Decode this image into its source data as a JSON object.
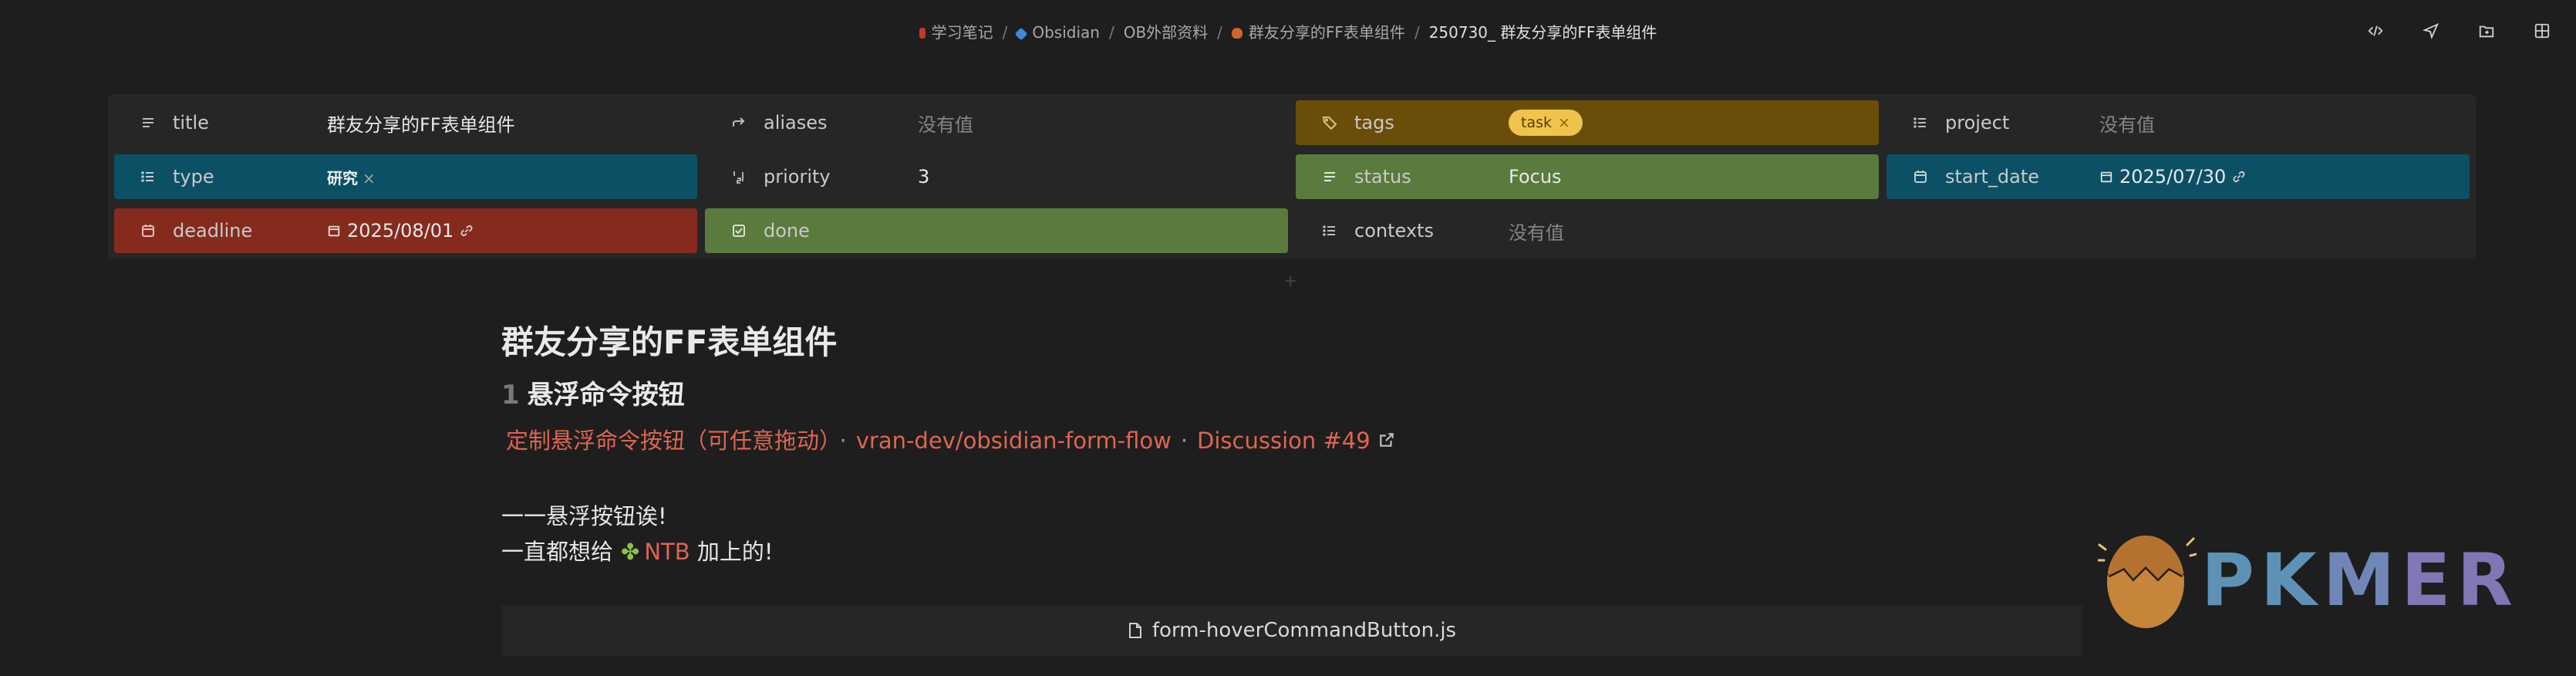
{
  "breadcrumb": {
    "items": [
      "学习笔记",
      "Obsidian",
      "OB外部资料",
      "群友分享的FF表单组件",
      "250730_ 群友分享的FF表单组件"
    ],
    "separator": "/"
  },
  "top_actions": [
    "code-icon",
    "send-icon",
    "folder-move-icon",
    "grid-icon"
  ],
  "properties": {
    "title": {
      "key": "title",
      "value": "群友分享的FF表单组件"
    },
    "aliases": {
      "key": "aliases",
      "value": "没有值"
    },
    "tags": {
      "key": "tags",
      "tag": "task",
      "remove": "×"
    },
    "project": {
      "key": "project",
      "value": "没有值"
    },
    "type": {
      "key": "type",
      "tag": "研究",
      "remove": "×"
    },
    "priority": {
      "key": "priority",
      "value": "3"
    },
    "status": {
      "key": "status",
      "value": "Focus"
    },
    "start_date": {
      "key": "start_date",
      "value": "2025/07/30"
    },
    "deadline": {
      "key": "deadline",
      "value": "2025/08/01"
    },
    "done": {
      "key": "done"
    },
    "contexts": {
      "key": "contexts",
      "value": "没有值"
    },
    "colors": {
      "yellow": "#6a4d08",
      "teal": "#0c5066",
      "green": "#5b7a3e",
      "red": "#852b1e",
      "tag_pill": "#f0c34d"
    }
  },
  "note": {
    "title": "群友分享的FF表单组件",
    "heading_num": "1",
    "heading": "悬浮命令按钮",
    "link1": "定制悬浮命令按钮（可任意拖动）",
    "link2": "vran-dev/obsidian-form-flow",
    "link3": "Discussion #49",
    "dot": "·",
    "line1": "一一悬浮按钮诶!",
    "line2_pre": "一直都想给",
    "line2_emoji": "✤",
    "line2_link": "NTB",
    "line2_post": "加上的!",
    "code_file": "form-hoverCommandButton.js",
    "link_color": "#e0654f"
  },
  "logo": {
    "text_p": "P",
    "text_k": "K",
    "text_m": "M",
    "text_e": "E",
    "text_r": "R"
  }
}
